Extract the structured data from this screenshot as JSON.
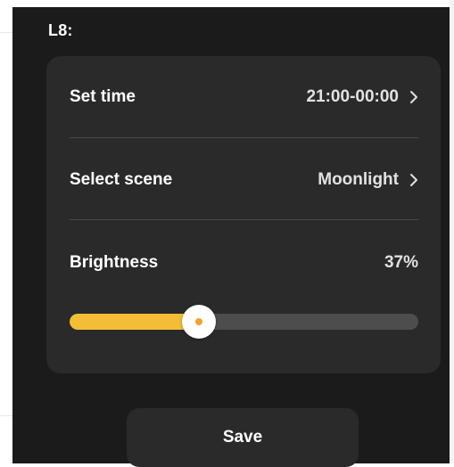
{
  "header": {
    "title": "L8:"
  },
  "settings": {
    "set_time": {
      "label": "Set time",
      "value": "21:00-00:00",
      "icon": "chevron-right-icon"
    },
    "select_scene": {
      "label": "Select scene",
      "value": "Moonlight",
      "icon": "chevron-right-icon"
    },
    "brightness": {
      "label": "Brightness",
      "value_text": "37%",
      "value": 37
    }
  },
  "actions": {
    "save_label": "Save"
  },
  "colors": {
    "background": "#1b1b1b",
    "card": "#2a2a2a",
    "accent": "#f3bd35",
    "track": "#4d4d4d",
    "text": "#ffffff"
  }
}
